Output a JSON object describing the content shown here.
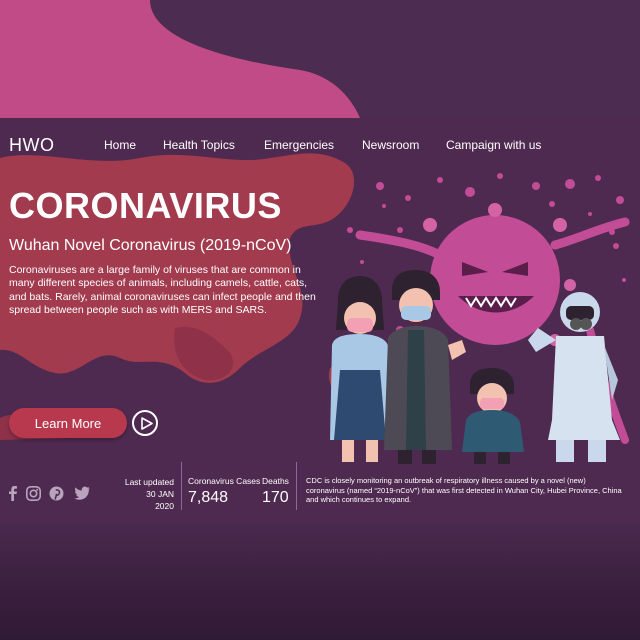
{
  "nav": {
    "logo": "HWO",
    "items": [
      "Home",
      "Health Topics",
      "Emergencies",
      "Newsroom",
      "Campaign with us"
    ]
  },
  "hero": {
    "title": "CORONAVIRUS",
    "subtitle": "Wuhan Novel Coronavirus (2019-nCoV)",
    "description": "Coronaviruses are a large family of viruses that are common in many different species of animals, including camels, cattle, cats, and bats. Rarely, animal coronaviruses can infect people and then spread between people such as with MERS and SARS.",
    "cta_label": "Learn More"
  },
  "social": [
    "facebook-icon",
    "instagram-icon",
    "pinterest-icon",
    "twitter-icon"
  ],
  "stats": {
    "updated_label": "Last updated",
    "updated_date": "30 JAN",
    "updated_year": "2020",
    "cases_label": "Coronavirus Cases",
    "cases_value": "7,848",
    "deaths_label": "Deaths",
    "deaths_value": "170"
  },
  "notice": "CDC is closely monitoring an outbreak of respiratory illness caused by a novel (new) coronavirus (named “2019-nCoV”) that was first detected in Wuhan City, Hubei Province, China and which continues to expand.",
  "colors": {
    "background": "#4a2a4e",
    "card": "#4f2a50",
    "accent_pink": "#c04b87",
    "map_red": "#a33b4f",
    "button": "#b8384e",
    "virus": "#c24d96"
  }
}
